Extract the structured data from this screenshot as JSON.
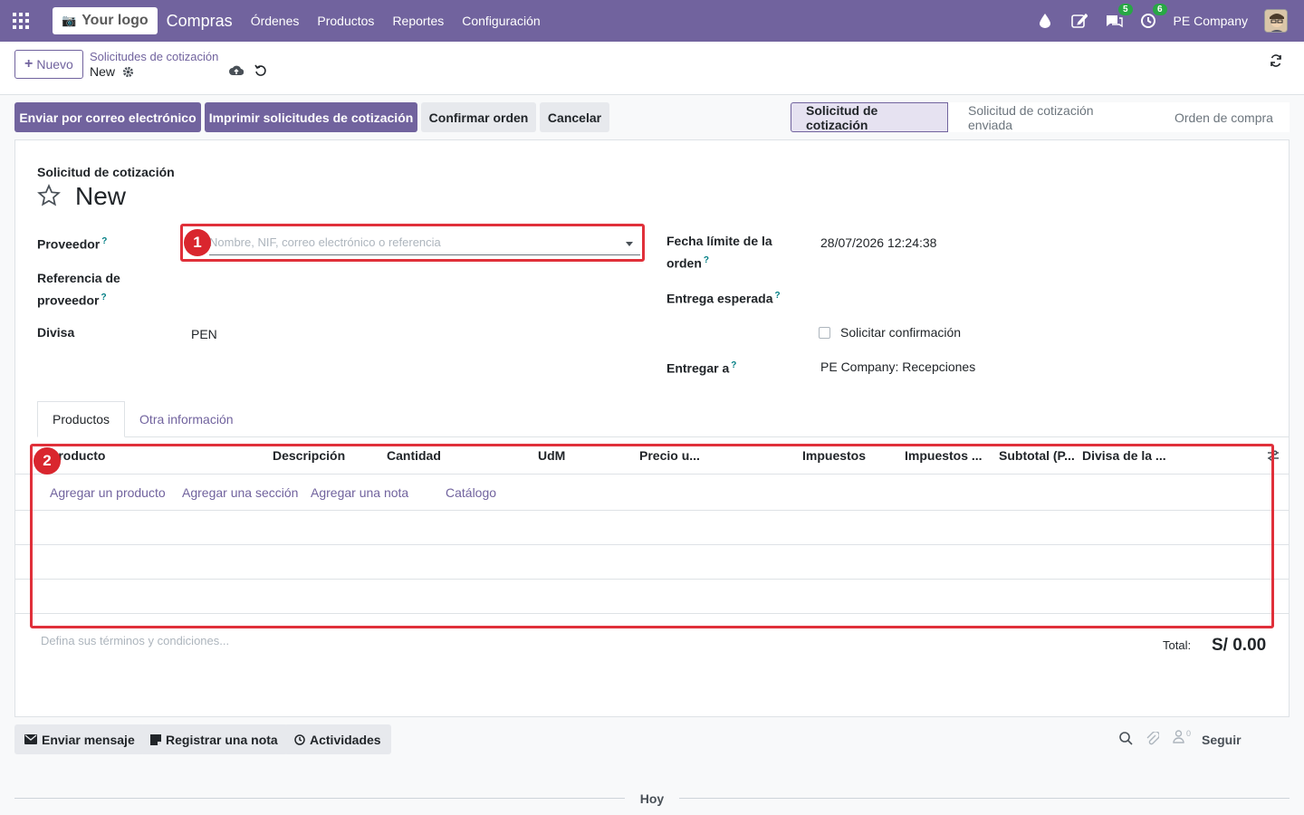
{
  "nav": {
    "logo_text": "Your logo",
    "app_name": "Compras",
    "menu": [
      "Órdenes",
      "Productos",
      "Reportes",
      "Configuración"
    ],
    "messages_badge": "5",
    "activities_badge": "6",
    "company": "PE Company"
  },
  "control": {
    "new_label": "Nuevo",
    "breadcrumb_parent": "Solicitudes de cotización",
    "breadcrumb_current": "New"
  },
  "actions": {
    "send_email": "Enviar por correo electrónico",
    "print_rfq": "Imprimir solicitudes de cotización",
    "confirm": "Confirmar orden",
    "cancel": "Cancelar"
  },
  "status": {
    "stages": [
      "Solicitud de cotización",
      "Solicitud de cotización enviada",
      "Orden de compra"
    ],
    "active_stage": "Solicitud de cotización"
  },
  "form": {
    "doc_type": "Solicitud de cotización",
    "title": "New",
    "vendor_label": "Proveedor",
    "vendor_placeholder": "Nombre, NIF, correo electrónico o referencia",
    "vendor_ref_label_1": "Referencia de",
    "vendor_ref_label_2": "proveedor",
    "currency_label": "Divisa",
    "currency_value": "PEN",
    "deadline_label_1": "Fecha límite de la",
    "deadline_label_2": "orden",
    "deadline_value": "28/07/2026 12:24:38",
    "expected_label": "Entrega esperada",
    "ask_confirmation": "Solicitar confirmación",
    "deliver_to_label": "Entregar a",
    "deliver_to_value": "PE Company: Recepciones"
  },
  "tabs": [
    "Productos",
    "Otra información"
  ],
  "lines": {
    "columns": [
      "Producto",
      "Descripción",
      "Cantidad",
      "UdM",
      "Precio u...",
      "Impuestos",
      "Impuestos ...",
      "Subtotal (P...",
      "Divisa de la ..."
    ],
    "add_product": "Agregar un producto",
    "add_section": "Agregar una sección",
    "add_note": "Agregar una nota",
    "catalog": "Catálogo"
  },
  "footer": {
    "terms_placeholder": "Defina sus términos y condiciones...",
    "total_label": "Total:",
    "total_value": "S/ 0.00"
  },
  "chatter": {
    "send_message": "Enviar mensaje",
    "log_note": "Registrar una nota",
    "activities": "Actividades",
    "followers_count": "0",
    "follow": "Seguir",
    "today": "Hoy"
  },
  "annotations": {
    "callout_1": "1",
    "callout_2": "2",
    "highlight_color": "#e0303a"
  },
  "colors": {
    "brand": "#71639e",
    "badge": "#28a745"
  }
}
